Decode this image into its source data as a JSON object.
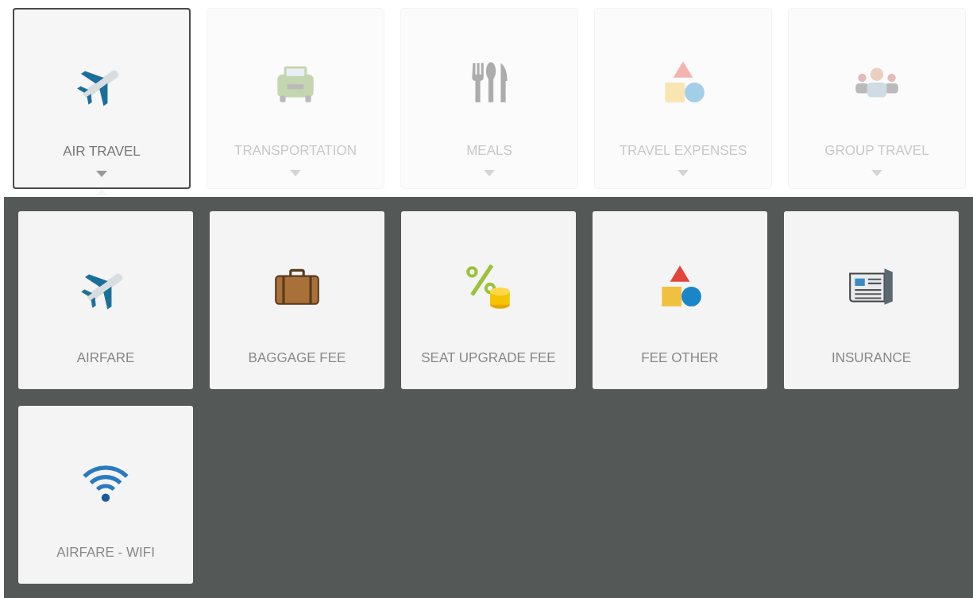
{
  "categories": [
    {
      "label": "AIR TRAVEL",
      "kind": "plane",
      "selected": true
    },
    {
      "label": "TRANSPORTATION",
      "kind": "car",
      "selected": false
    },
    {
      "label": "MEALS",
      "kind": "cutlery",
      "selected": false
    },
    {
      "label": "TRAVEL EXPENSES",
      "kind": "shapes",
      "selected": false
    },
    {
      "label": "GROUP TRAVEL",
      "kind": "group",
      "selected": false
    }
  ],
  "subcategories": [
    {
      "label": "AIRFARE",
      "kind": "plane"
    },
    {
      "label": "BAGGAGE FEE",
      "kind": "suitcase"
    },
    {
      "label": "SEAT UPGRADE FEE",
      "kind": "percent"
    },
    {
      "label": "FEE OTHER",
      "kind": "shapes"
    },
    {
      "label": "INSURANCE",
      "kind": "newspaper"
    },
    {
      "label": "AIRFARE - WIFI",
      "kind": "wifi"
    }
  ]
}
